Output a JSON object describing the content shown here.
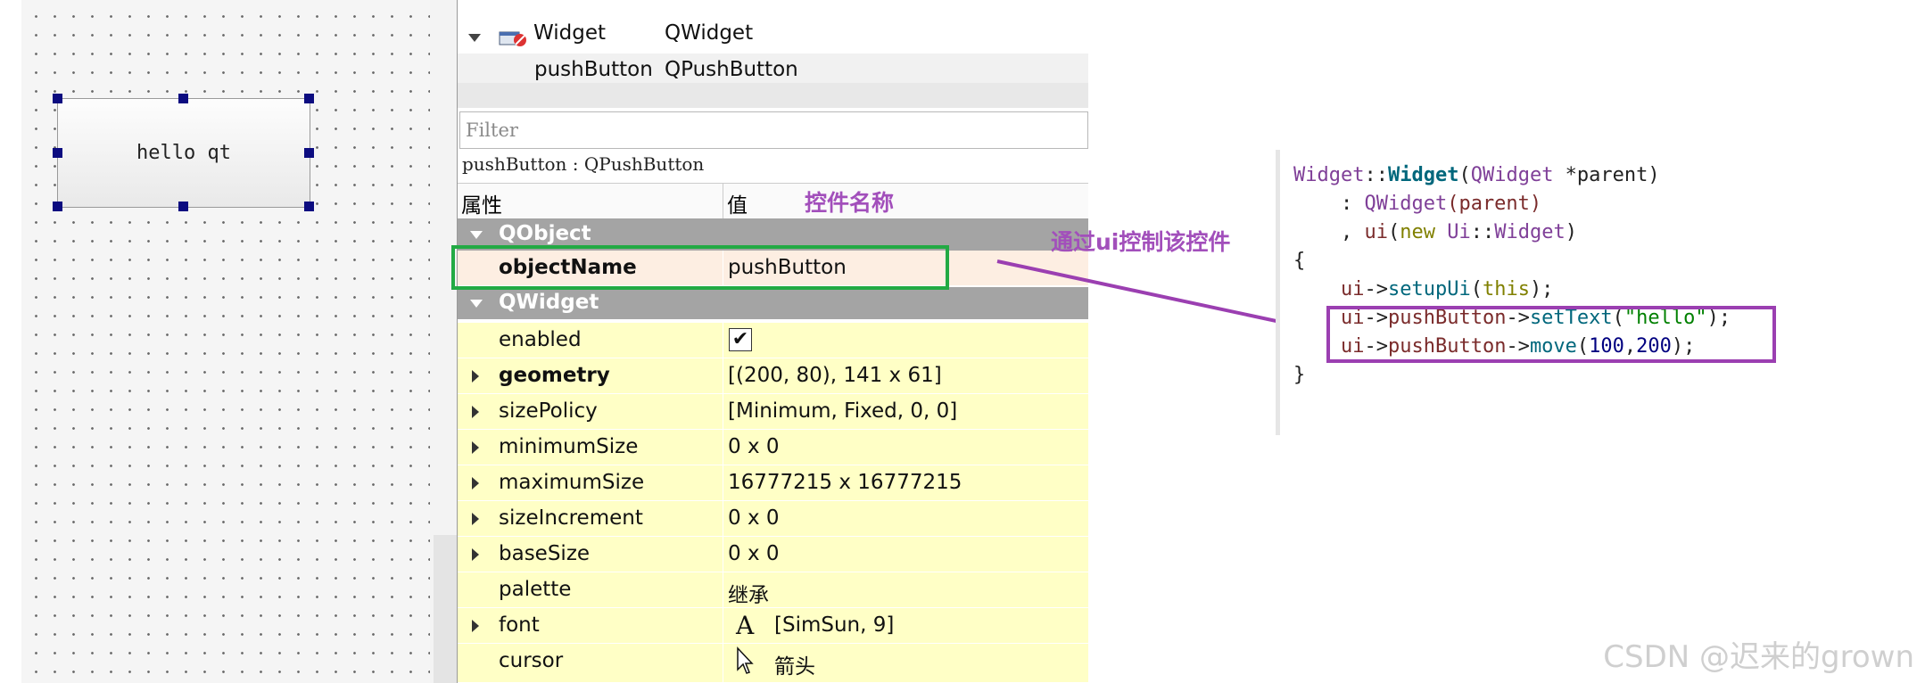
{
  "designer": {
    "button_text": "hello qt"
  },
  "object_tree": {
    "rows": [
      {
        "name": "Widget",
        "class": "QWidget"
      },
      {
        "name": "pushButton",
        "class": "QPushButton"
      }
    ]
  },
  "property_editor": {
    "filter_placeholder": "Filter",
    "current_object": "pushButton : QPushButton",
    "header": {
      "property": "属性",
      "value": "值"
    },
    "groups": [
      {
        "label": "QObject"
      },
      {
        "label": "QWidget"
      }
    ],
    "object_name": {
      "name": "objectName",
      "value": "pushButton"
    },
    "properties": [
      {
        "name": "enabled",
        "value": "✔"
      },
      {
        "name": "geometry",
        "value": "[(200, 80), 141 x 61]"
      },
      {
        "name": "sizePolicy",
        "value": "[Minimum, Fixed, 0, 0]"
      },
      {
        "name": "minimumSize",
        "value": "0 x 0"
      },
      {
        "name": "maximumSize",
        "value": "16777215 x 16777215"
      },
      {
        "name": "sizeIncrement",
        "value": "0 x 0"
      },
      {
        "name": "baseSize",
        "value": "0 x 0"
      },
      {
        "name": "palette",
        "value": "继承"
      },
      {
        "name": "font",
        "value": "[SimSun, 9]",
        "icon_text": "A"
      },
      {
        "name": "cursor",
        "value": "箭头"
      }
    ]
  },
  "annotations": {
    "control_name": "控件名称",
    "control_via_ui": "通过ui控制该控件",
    "colors": {
      "label": "#a24fbb",
      "green_box": "#22aa44",
      "purple_box": "#9b3fb1"
    }
  },
  "code": {
    "l1": {
      "cls": "Widget",
      "sep": "::",
      "fn": "Widget",
      "p": "(",
      "type": "QWidget",
      "rest": " *parent)"
    },
    "l2": {
      "indent": "    : ",
      "fn": "QWidget",
      "rest": "(parent)"
    },
    "l3": {
      "indent": "    , ",
      "ptr": "ui",
      "p1": "(",
      "kw": "new",
      "sp": " ",
      "cls": "Ui",
      "sep": "::",
      "name": "Widget",
      "p2": ")"
    },
    "l4": {
      "text": "{"
    },
    "l5": {
      "indent": "    ",
      "ptr": "ui",
      "arrow": "->",
      "fn": "setupUi",
      "p1": "(",
      "kw": "this",
      "p2": ");"
    },
    "l6": {
      "indent": "    ",
      "ptr": "ui",
      "arrow1": "->",
      "member": "pushButton",
      "arrow2": "->",
      "fn": "setText",
      "p1": "(",
      "str": "\"hello\"",
      "p2": ");"
    },
    "l7": {
      "indent": "    ",
      "ptr": "ui",
      "arrow1": "->",
      "member": "pushButton",
      "arrow2": "->",
      "fn": "move",
      "p1": "(",
      "n1": "100",
      "comma": ",",
      "n2": "200",
      "p2": ");"
    },
    "l8": {
      "text": "}"
    }
  },
  "watermark": "CSDN @迟来的grown"
}
